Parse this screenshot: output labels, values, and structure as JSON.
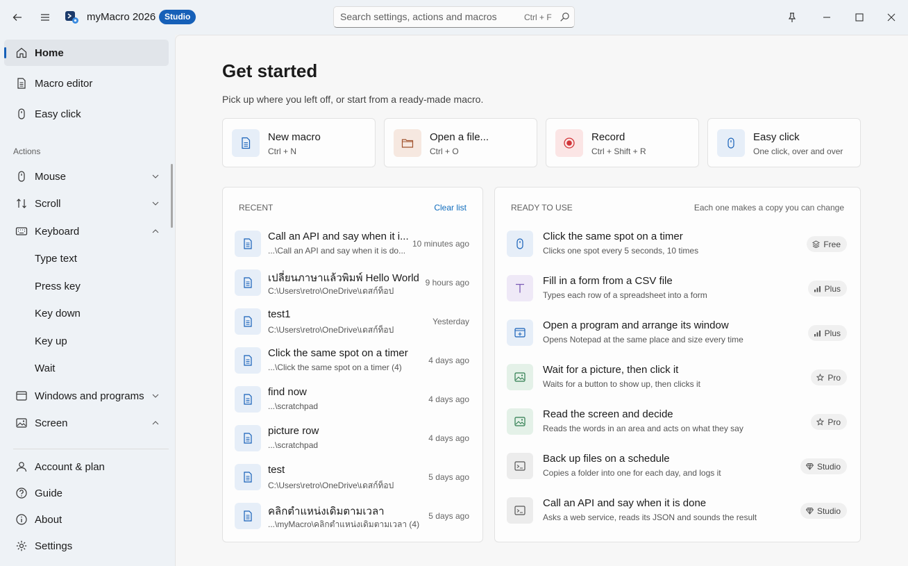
{
  "app": {
    "title": "myMacro 2026",
    "badge": "Studio"
  },
  "search": {
    "placeholder": "Search settings, actions and macros",
    "shortcut": "Ctrl + F"
  },
  "sidebar": {
    "top": [
      {
        "label": "Home",
        "icon": "home-icon"
      },
      {
        "label": "Macro editor",
        "icon": "document-icon"
      },
      {
        "label": "Easy click",
        "icon": "mouse-icon"
      }
    ],
    "section_label": "Actions",
    "actions": [
      {
        "label": "Mouse",
        "icon": "mouse-icon"
      },
      {
        "label": "Scroll",
        "icon": "scroll-icon"
      },
      {
        "label": "Keyboard",
        "icon": "keyboard-icon"
      },
      {
        "label": "Type text"
      },
      {
        "label": "Press key"
      },
      {
        "label": "Key down"
      },
      {
        "label": "Key up"
      },
      {
        "label": "Wait"
      },
      {
        "label": "Windows and programs",
        "icon": "window-icon"
      },
      {
        "label": "Screen",
        "icon": "image-icon"
      }
    ],
    "bottom": [
      {
        "label": "Account & plan",
        "icon": "person-icon"
      },
      {
        "label": "Guide",
        "icon": "help-icon"
      },
      {
        "label": "About",
        "icon": "info-icon"
      },
      {
        "label": "Settings",
        "icon": "gear-icon"
      }
    ]
  },
  "main": {
    "title": "Get started",
    "subtitle": "Pick up where you left off, or start from a ready-made macro.",
    "quick_actions": [
      {
        "title": "New macro",
        "sub": "Ctrl + N",
        "icon": "document-icon",
        "tint": "#e6eef8"
      },
      {
        "title": "Open a file...",
        "sub": "Ctrl + O",
        "icon": "folder-icon",
        "tint": "#f6e8e0"
      },
      {
        "title": "Record",
        "sub": "Ctrl + Shift + R",
        "icon": "record-icon",
        "tint": "#fbe5e5"
      },
      {
        "title": "Easy click",
        "sub": "One click, over and over",
        "icon": "mouse-icon",
        "tint": "#e6eef8"
      }
    ],
    "recent": {
      "header": "RECENT",
      "action": "Clear list",
      "items": [
        {
          "title": "Call an API and say when it i...",
          "path": "...\\Call an API and say when it is do...",
          "time": "10 minutes ago"
        },
        {
          "title": "เปลี่ยนภาษาแล้วพิมพ์ Hello World",
          "path": "C:\\Users\\retro\\OneDrive\\เดสก์ท็อป",
          "time": "9 hours ago"
        },
        {
          "title": "test1",
          "path": "C:\\Users\\retro\\OneDrive\\เดสก์ท็อป",
          "time": "Yesterday"
        },
        {
          "title": "Click the same spot on a timer",
          "path": "...\\Click the same spot on a timer (4)",
          "time": "4 days ago"
        },
        {
          "title": "find now",
          "path": "...\\scratchpad",
          "time": "4 days ago"
        },
        {
          "title": "picture row",
          "path": "...\\scratchpad",
          "time": "4 days ago"
        },
        {
          "title": "test",
          "path": "C:\\Users\\retro\\OneDrive\\เดสก์ท็อป",
          "time": "5 days ago"
        },
        {
          "title": "คลิกตำแหน่งเดิมตามเวลา",
          "path": "...\\myMacro\\คลิกตำแหน่งเดิมตามเวลา (4)",
          "time": "5 days ago"
        }
      ]
    },
    "ready": {
      "header": "READY TO USE",
      "note": "Each one makes a copy you can change",
      "items": [
        {
          "title": "Click the same spot on a timer",
          "sub": "Clicks one spot every 5 seconds, 10 times",
          "tier": "Free",
          "icon": "mouse-icon",
          "tier_icon": "layers-icon",
          "tint": "#e6eef8"
        },
        {
          "title": "Fill in a form from a CSV file",
          "sub": "Types each row of a spreadsheet into a form",
          "tier": "Plus",
          "icon": "text-icon",
          "tier_icon": "bars-icon",
          "tint": "#efe9f7"
        },
        {
          "title": "Open a program and arrange its window",
          "sub": "Opens Notepad at the same place and size every time",
          "tier": "Plus",
          "icon": "window-add-icon",
          "tier_icon": "bars-icon",
          "tint": "#e6eef8"
        },
        {
          "title": "Wait for a picture, then click it",
          "sub": "Waits for a button to show up, then clicks it",
          "tier": "Pro",
          "icon": "image-icon",
          "tier_icon": "star-icon",
          "tint": "#e4f1e8"
        },
        {
          "title": "Read the screen and decide",
          "sub": "Reads the words in an area and acts on what they say",
          "tier": "Pro",
          "icon": "image-icon",
          "tier_icon": "star-icon",
          "tint": "#e4f1e8"
        },
        {
          "title": "Back up files on a schedule",
          "sub": "Copies a folder into one for each day, and logs it",
          "tier": "Studio",
          "icon": "terminal-icon",
          "tier_icon": "diamond-icon",
          "tint": "#ececec"
        },
        {
          "title": "Call an API and say when it is done",
          "sub": "Asks a web service, reads its JSON and sounds the result",
          "tier": "Studio",
          "icon": "terminal-icon",
          "tier_icon": "diamond-icon",
          "tint": "#ececec"
        }
      ]
    }
  },
  "colors": {
    "accent": "#1660b8",
    "link": "#0f6cbd",
    "record": "#d13438"
  }
}
